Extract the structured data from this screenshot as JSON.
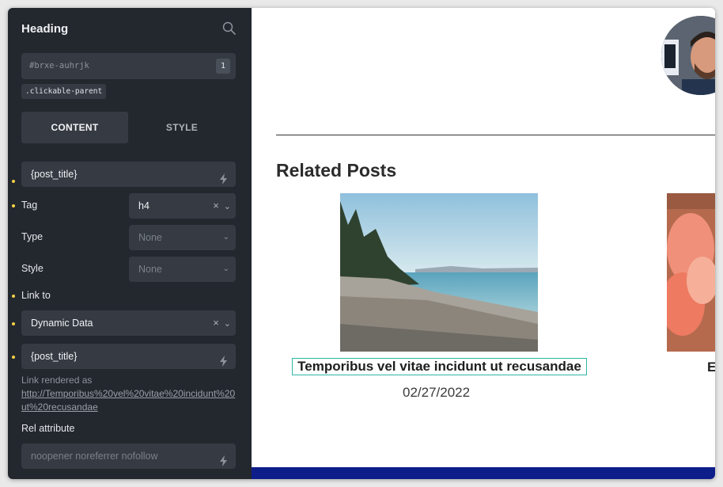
{
  "panel": {
    "title": "Heading",
    "element_id": "#brxe-auhrjk",
    "element_id_badge": "1",
    "class_chip": ".clickable-parent",
    "tabs": {
      "content": "CONTENT",
      "style": "STYLE"
    },
    "text_value": "{post_title}",
    "tag": {
      "label": "Tag",
      "value": "h4"
    },
    "type": {
      "label": "Type",
      "value": "None"
    },
    "style": {
      "label": "Style",
      "value": "None"
    },
    "link_to": {
      "label": "Link to",
      "value": "Dynamic Data"
    },
    "link_value": "{post_title}",
    "link_rendered_label": "Link rendered as",
    "link_rendered_url": "http://Temporibus%20vel%20vitae%20incidunt%20ut%20recusandae",
    "rel": {
      "label": "Rel attribute",
      "placeholder": "noopener noreferrer nofollow"
    },
    "accent_color": "#f5d142"
  },
  "page": {
    "related_heading": "Related Posts",
    "post_title": "Temporibus vel vitae incidunt ut recusandae",
    "post_date": "02/27/2022",
    "post2_title_partial": "E",
    "footer_color": "#0d1e8a",
    "selection_color": "#2db6a6"
  }
}
